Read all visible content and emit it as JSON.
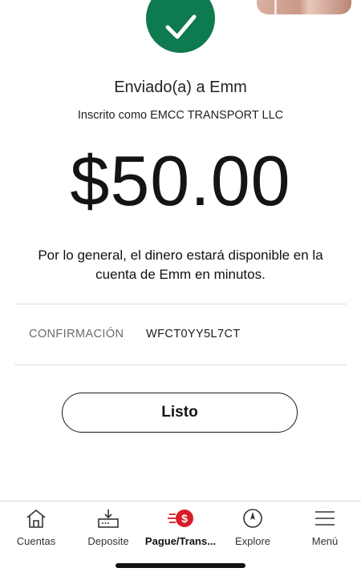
{
  "confirmation_screen": {
    "sent_to": "Enviado(a) a Emm",
    "enrolled_as": "Inscrito como EMCC TRANSPORT LLC",
    "amount": "$50.00",
    "availability_note": "Por lo general, el dinero estará disponible en la cuenta de Emm en minutos.",
    "confirmation_label": "CONFIRMACIÓN",
    "confirmation_code": "WFCT0YY5L7CT",
    "done_label": "Listo",
    "success_color": "#0d7a4f",
    "success_icon": "checkmark-icon"
  },
  "tabbar": {
    "items": [
      {
        "label": "Cuentas",
        "icon": "home-icon"
      },
      {
        "label": "Deposite",
        "icon": "deposit-icon"
      },
      {
        "label": "Pague/Trans...",
        "icon": "pay-transfer-icon",
        "active": true
      },
      {
        "label": "Explore",
        "icon": "compass-icon"
      },
      {
        "label": "Menú",
        "icon": "menu-icon"
      }
    ],
    "accent_color": "#d71e28"
  }
}
